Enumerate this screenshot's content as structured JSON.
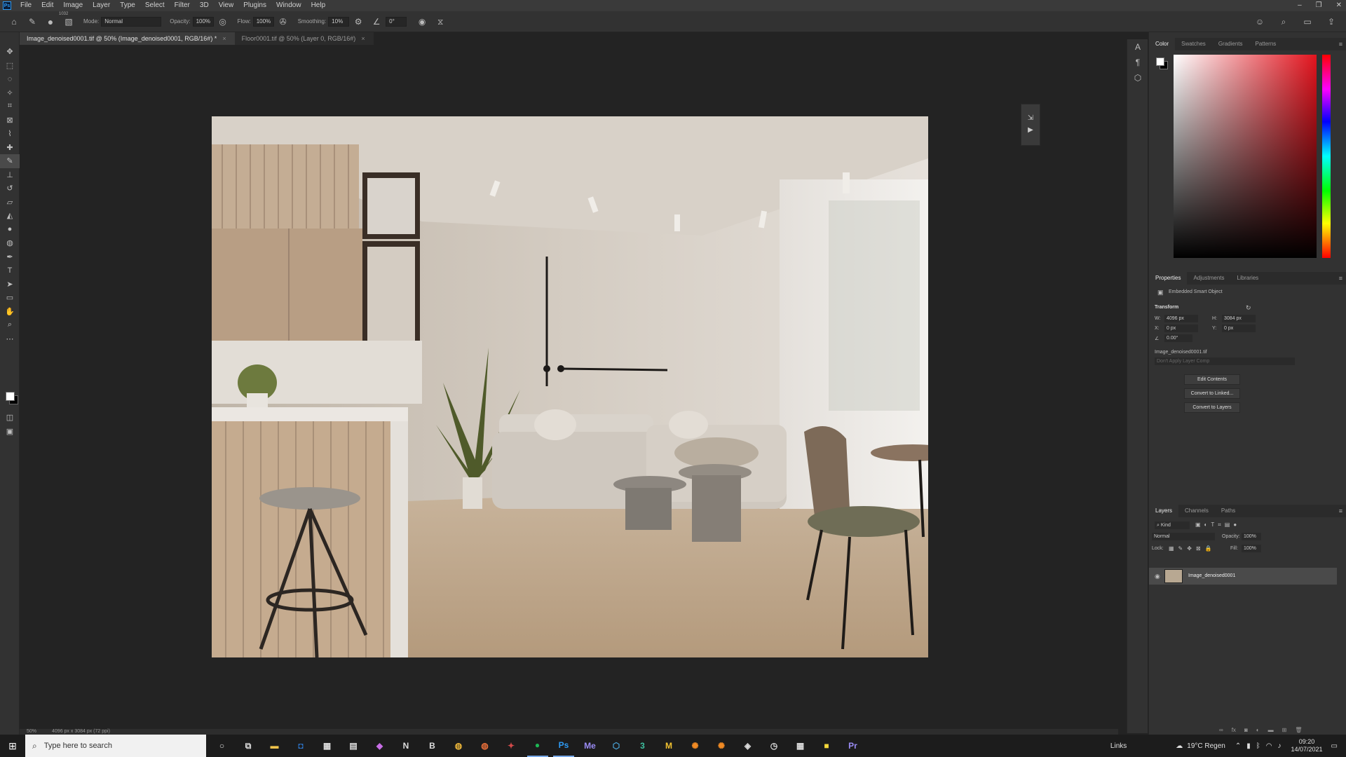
{
  "menubar": {
    "logo": "Ps",
    "items": [
      "File",
      "Edit",
      "Image",
      "Layer",
      "Type",
      "Select",
      "Filter",
      "3D",
      "View",
      "Plugins",
      "Window",
      "Help"
    ]
  },
  "window_controls": [
    "–",
    "❐",
    "✕"
  ],
  "options_bar": {
    "brush_size": "1032",
    "mode_label": "Mode:",
    "mode_value": "Normal",
    "opacity_label": "Opacity:",
    "opacity_value": "100%",
    "flow_label": "Flow:",
    "flow_value": "100%",
    "smoothing_label": "Smoothing:",
    "smoothing_value": "10%",
    "angle_value": "0°"
  },
  "tabs": [
    {
      "label": "Image_denoised0001.tif @ 50% (Image_denoised0001, RGB/16#) *",
      "active": true
    },
    {
      "label": "Floor0001.tif @ 50% (Layer 0, RGB/16#)",
      "active": false
    }
  ],
  "tools": [
    "move-tool",
    "marquee-tool",
    "lasso-tool",
    "magic-wand-tool",
    "crop-tool",
    "frame-tool",
    "eyedropper-tool",
    "healing-tool",
    "brush-tool",
    "stamp-tool",
    "history-brush-tool",
    "eraser-tool",
    "bucket-tool",
    "blur-tool",
    "dodge-tool",
    "pen-tool",
    "type-tool",
    "path-select-tool",
    "shape-tool",
    "hand-tool",
    "zoom-tool",
    "more-tools"
  ],
  "status": {
    "zoom": "50%",
    "doc_size": "4096 px x 3084 px (72 ppi)"
  },
  "color_panel": {
    "tabs": [
      "Color",
      "Swatches",
      "Gradients",
      "Patterns"
    ]
  },
  "properties_panel": {
    "tabs": [
      "Properties",
      "Adjustments",
      "Libraries"
    ],
    "kind": "Embedded Smart Object",
    "section": "Transform",
    "w_label": "W:",
    "w_value": "4096 px",
    "h_label": "H:",
    "h_value": "3084 px",
    "x_label": "X:",
    "x_value": "0 px",
    "y_label": "Y:",
    "y_value": "0 px",
    "angle_value": "0.00°",
    "file_name": "Image_denoised0001.tif",
    "layer_comp": "Don't Apply Layer Comp",
    "buttons": [
      "Edit Contents",
      "Convert to Linked...",
      "Convert to Layers"
    ]
  },
  "layers_panel": {
    "tabs": [
      "Layers",
      "Channels",
      "Paths"
    ],
    "filter_label": "Kind",
    "blend_mode": "Normal",
    "opacity_label": "Opacity:",
    "opacity_value": "100%",
    "lock_label": "Lock:",
    "fill_label": "Fill:",
    "fill_value": "100%",
    "layer_name": "Image_denoised0001"
  },
  "taskbar": {
    "search_placeholder": "Type here to search",
    "apps": [
      "File Explorer",
      "Outlook",
      "Calculator",
      "Folder",
      "Affinity",
      "OneNote",
      "Bitwarden",
      "Chrome",
      "Chrome Canary",
      "Paint",
      "Spotify",
      "Ps",
      "Me",
      "SketchUp",
      "3",
      "M",
      "Blender",
      "Blender Beta",
      "Unity",
      "Clock",
      "Calendar",
      "Sticky Notes",
      "Pr"
    ],
    "links_label": "Links",
    "weather": "19°C Regen",
    "time": "09:20",
    "date": "14/07/2021"
  },
  "colors": {
    "app_bg": "#232323",
    "panel_bg": "#323232",
    "accent": "#2e9bf5"
  }
}
